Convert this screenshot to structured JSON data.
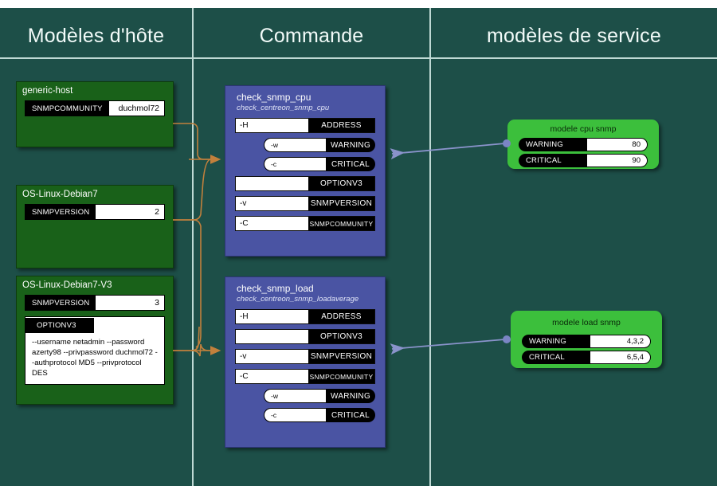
{
  "columns": [
    {
      "id": "host",
      "title": "Modèles d'hôte"
    },
    {
      "id": "command",
      "title": "Commande"
    },
    {
      "id": "service",
      "title": "modèles de service"
    }
  ],
  "colors": {
    "board": "#1d4f48",
    "grid": "#bfd9d4",
    "host_node": "#196119",
    "command_node": "#4a54a3",
    "service_node": "#3cbf3c",
    "host_link": "#c89a6a",
    "service_link": "#7b85c4",
    "label_bg": "#000000",
    "value_bg": "#ffffff"
  },
  "host_templates": [
    {
      "name": "generic-host",
      "fields": [
        {
          "key": "SNMPCOMMUNITY",
          "value": "duchmol72"
        }
      ]
    },
    {
      "name": "OS-Linux-Debian7",
      "fields": [
        {
          "key": "SNMPVERSION",
          "value": "2"
        }
      ]
    },
    {
      "name": "OS-Linux-Debian7-V3",
      "fields": [
        {
          "key": "SNMPVERSION",
          "value": "3"
        }
      ],
      "option_block": {
        "key": "OPTIONV3",
        "text": "--username netadmin --password azerty98 --privpassword duchmol72 --authprotocol MD5 --privprotocol DES"
      }
    }
  ],
  "commands": [
    {
      "name": "check_snmp_cpu",
      "binary": "check_centreon_snmp_cpu",
      "args": [
        {
          "flag": "-H",
          "macro": "ADDRESS",
          "shape": "rect"
        },
        {
          "flag": "-w",
          "macro": "WARNING",
          "shape": "pill"
        },
        {
          "flag": "-c",
          "macro": "CRITICAL",
          "shape": "pill"
        },
        {
          "flag": "",
          "macro": "OPTIONV3",
          "shape": "rect"
        },
        {
          "flag": "-v",
          "macro": "SNMPVERSION",
          "shape": "rect"
        },
        {
          "flag": "-C",
          "macro": "SNMPCOMMUNITY",
          "shape": "rect",
          "small": true
        }
      ]
    },
    {
      "name": "check_snmp_load",
      "binary": "check_centreon_snmp_loadaverage",
      "args": [
        {
          "flag": "-H",
          "macro": "ADDRESS",
          "shape": "rect"
        },
        {
          "flag": "",
          "macro": "OPTIONV3",
          "shape": "rect"
        },
        {
          "flag": "-v",
          "macro": "SNMPVERSION",
          "shape": "rect"
        },
        {
          "flag": "-C",
          "macro": "SNMPCOMMUNITY",
          "shape": "rect",
          "small": true
        },
        {
          "flag": "-w",
          "macro": "WARNING",
          "shape": "pill"
        },
        {
          "flag": "-c",
          "macro": "CRITICAL",
          "shape": "pill"
        }
      ]
    }
  ],
  "service_templates": [
    {
      "name": "modele cpu snmp",
      "fields": [
        {
          "key": "WARNING",
          "value": "80"
        },
        {
          "key": "CRITICAL",
          "value": "90"
        }
      ]
    },
    {
      "name": "modele load snmp",
      "fields": [
        {
          "key": "WARNING",
          "value": "4,3,2"
        },
        {
          "key": "CRITICAL",
          "value": "6,5,4"
        }
      ]
    }
  ]
}
